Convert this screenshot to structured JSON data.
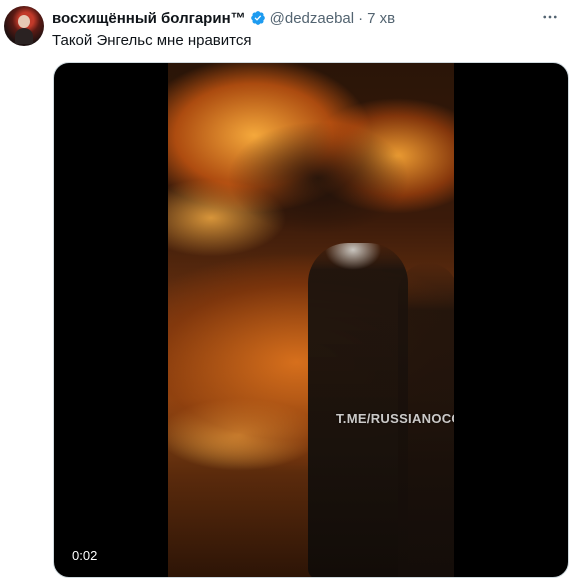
{
  "tweet": {
    "display_name": "восхищённый болгарин™",
    "handle": "@dedzaebal",
    "separator": "·",
    "time": "7 хв",
    "text": "Такой Энгельс мне нравится"
  },
  "media": {
    "type": "video",
    "watermark": "T.ME/RUSSIANOCONTEXT",
    "duration": "0:02"
  },
  "icons": {
    "verified": "verified-badge-icon",
    "more": "more-options-icon"
  },
  "colors": {
    "verified": "#1d9bf0",
    "secondary_text": "#536471"
  }
}
